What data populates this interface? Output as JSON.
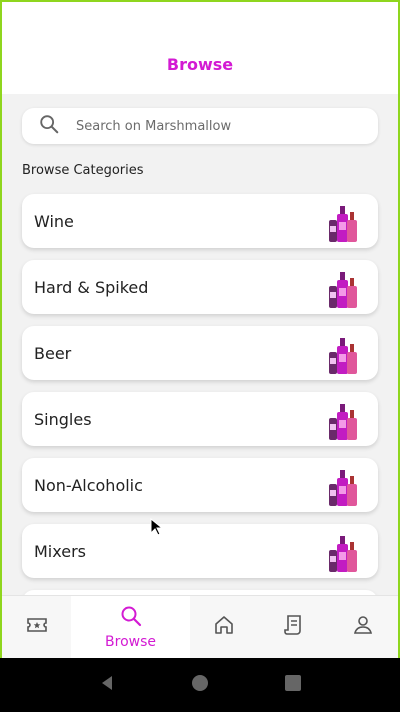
{
  "header": {
    "title": "Browse"
  },
  "search": {
    "placeholder": "Search on Marshmallow",
    "icon": "search-icon"
  },
  "section": {
    "title": "Browse Categories"
  },
  "categories": [
    {
      "label": "Wine"
    },
    {
      "label": "Hard & Spiked"
    },
    {
      "label": "Beer"
    },
    {
      "label": "Singles"
    },
    {
      "label": "Non-Alcoholic"
    },
    {
      "label": "Mixers"
    }
  ],
  "tabbar": {
    "tabs": [
      {
        "icon": "ticket-star-icon"
      },
      {
        "icon": "search-icon",
        "label": "Browse",
        "active": true
      },
      {
        "icon": "home-icon"
      },
      {
        "icon": "receipt-icon"
      },
      {
        "icon": "profile-icon"
      }
    ]
  },
  "colors": {
    "accent": "#d31ad3",
    "frame": "#8fd61e",
    "background": "#f2f2f2"
  }
}
